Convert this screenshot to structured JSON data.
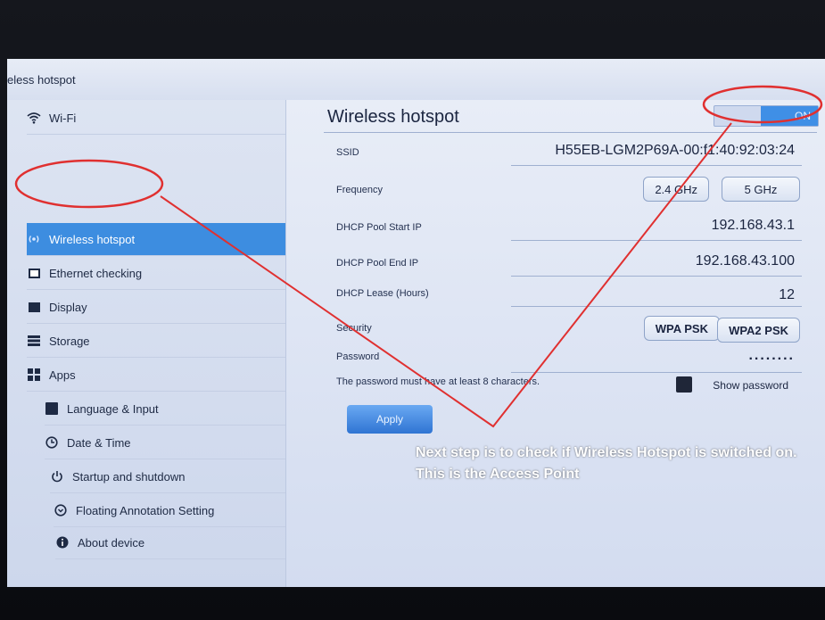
{
  "window": {
    "title": "eless hotspot"
  },
  "nav": {
    "items": [
      {
        "label": "Wi-Fi",
        "icon": "wifi-icon",
        "active": false
      },
      {
        "label": "Wireless hotspot",
        "icon": "hotspot-icon",
        "active": true
      },
      {
        "label": "Ethernet checking",
        "icon": "ethernet-icon",
        "active": false
      },
      {
        "label": "Display",
        "icon": "display-icon",
        "active": false
      },
      {
        "label": "Storage",
        "icon": "storage-icon",
        "active": false
      },
      {
        "label": "Apps",
        "icon": "apps-icon",
        "active": false
      },
      {
        "label": "Language & Input",
        "icon": "language-icon",
        "active": false
      },
      {
        "label": "Date & Time",
        "icon": "clock-icon",
        "active": false
      },
      {
        "label": "Startup and shutdown",
        "icon": "power-icon",
        "active": false
      },
      {
        "label": "Floating Annotation Setting",
        "icon": "annotation-icon",
        "active": false
      },
      {
        "label": "About device",
        "icon": "info-icon",
        "active": false
      }
    ]
  },
  "panel": {
    "title": "Wireless hotspot",
    "toggle": "ON",
    "ssid": {
      "label": "SSID",
      "value": "H55EB-LGM2P69A-00:f1:40:92:03:24"
    },
    "frequency": {
      "label": "Frequency",
      "options": [
        "2.4 GHz",
        "5 GHz"
      ]
    },
    "dhcp_start": {
      "label": "DHCP Pool Start IP",
      "value": "192.168.43.1"
    },
    "dhcp_end": {
      "label": "DHCP Pool End IP",
      "value": "192.168.43.100"
    },
    "lease": {
      "label": "DHCP Lease (Hours)",
      "value": "12"
    },
    "security": {
      "label": "Security",
      "options": [
        "WPA PSK",
        "WPA2 PSK"
      ]
    },
    "password": {
      "label": "Password",
      "value": "........"
    },
    "hint": "The password must have at least 8 characters.",
    "show_password": "Show password",
    "apply": "Apply"
  },
  "annotation": {
    "text": "Next step is to check if Wireless Hotspot is switched on. This is the Access Point",
    "color": "#e03030"
  },
  "colors": {
    "accent": "#3d8de0"
  }
}
